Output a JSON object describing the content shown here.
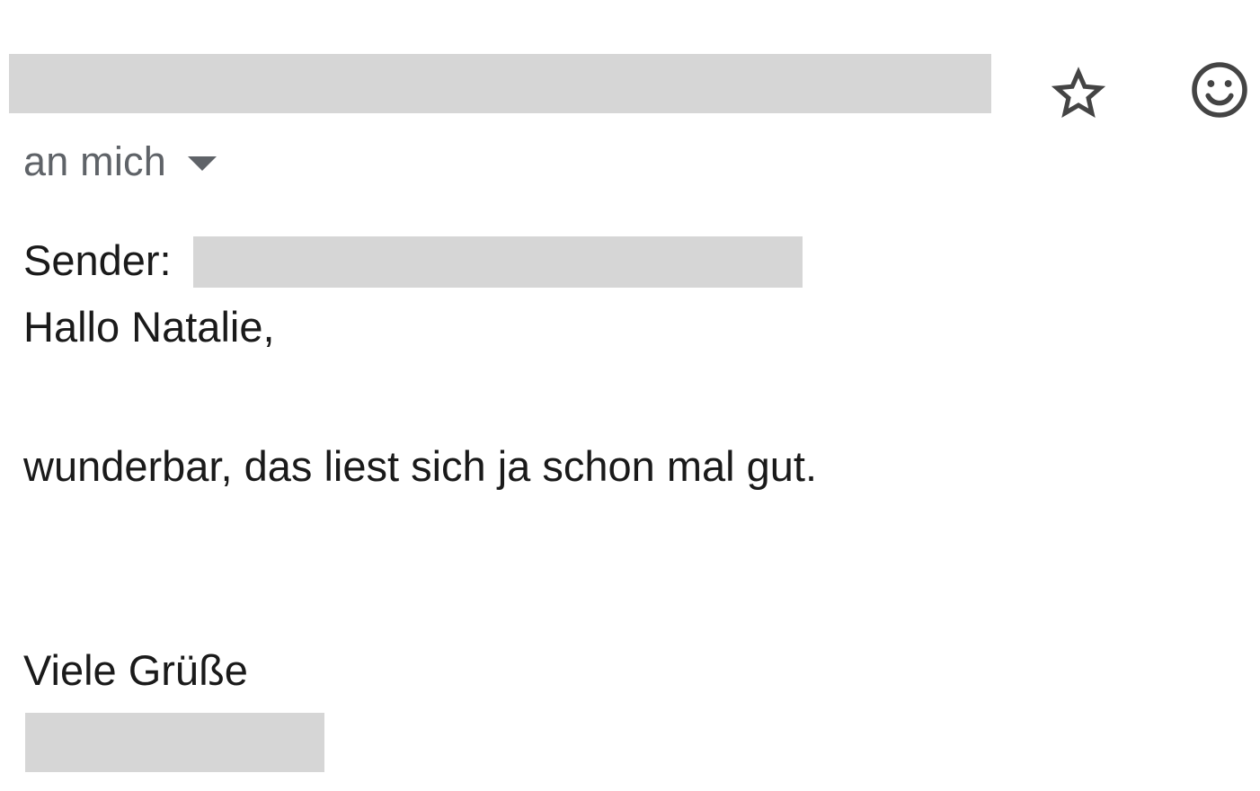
{
  "header": {
    "star_icon": "star-icon",
    "emoji_icon": "emoji-icon"
  },
  "recipient": {
    "label": "an mich",
    "dropdown_icon": "caret-down-icon"
  },
  "body": {
    "sender_label": "Sender:",
    "greeting": "Hallo Natalie,",
    "text": "wunderbar, das liest sich ja schon mal gut.",
    "closing": "Viele Grüße"
  },
  "colors": {
    "redaction": "#d6d6d6",
    "muted_text": "#5f6368",
    "icon": "#444444"
  }
}
